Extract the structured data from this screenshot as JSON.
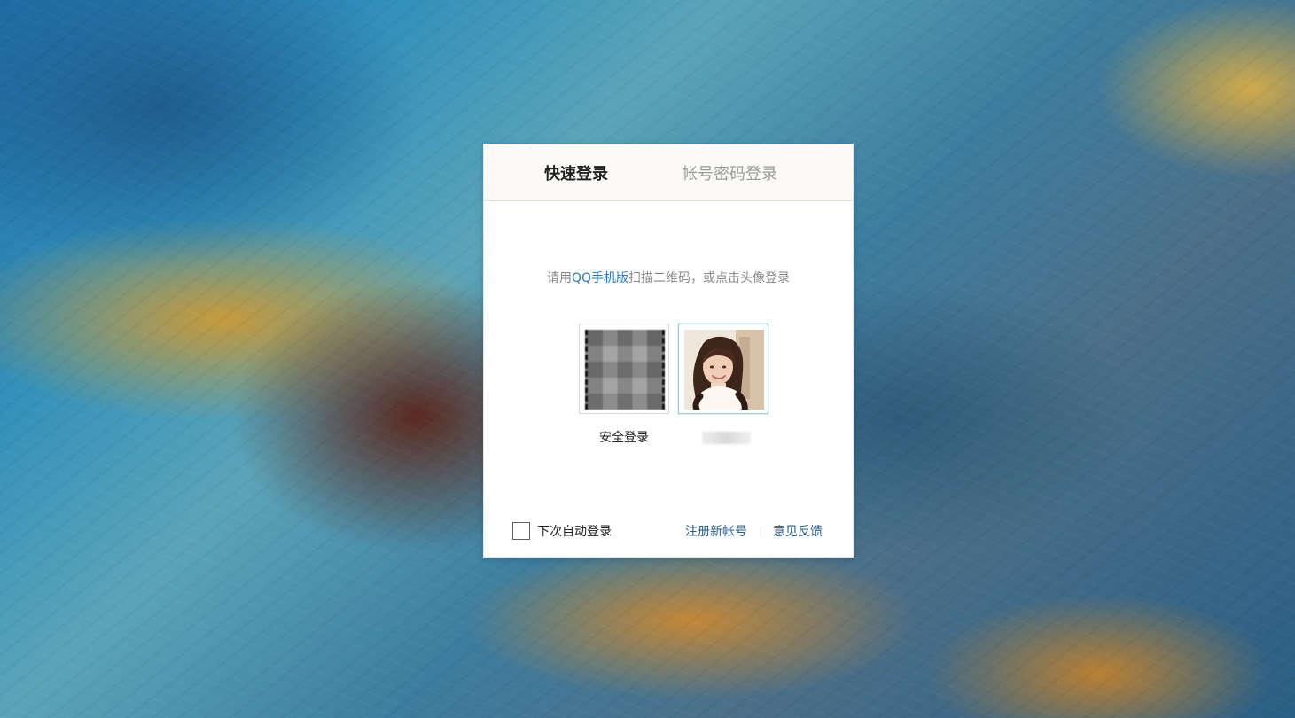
{
  "tabs": {
    "quick_login": "快速登录",
    "account_login": "帐号密码登录"
  },
  "instruction": {
    "prefix": "请用",
    "highlight": "QQ手机版",
    "suffix": "扫描二维码，或点击头像登录"
  },
  "tiles": {
    "qr_label": "安全登录"
  },
  "footer": {
    "remember_label": "下次自动登录",
    "register_label": "注册新帐号",
    "feedback_label": "意见反馈"
  },
  "colors": {
    "link": "#2a5d85",
    "highlight": "#2e78b7",
    "active_tab": "#222222",
    "inactive_tab": "#9a9a9a"
  }
}
